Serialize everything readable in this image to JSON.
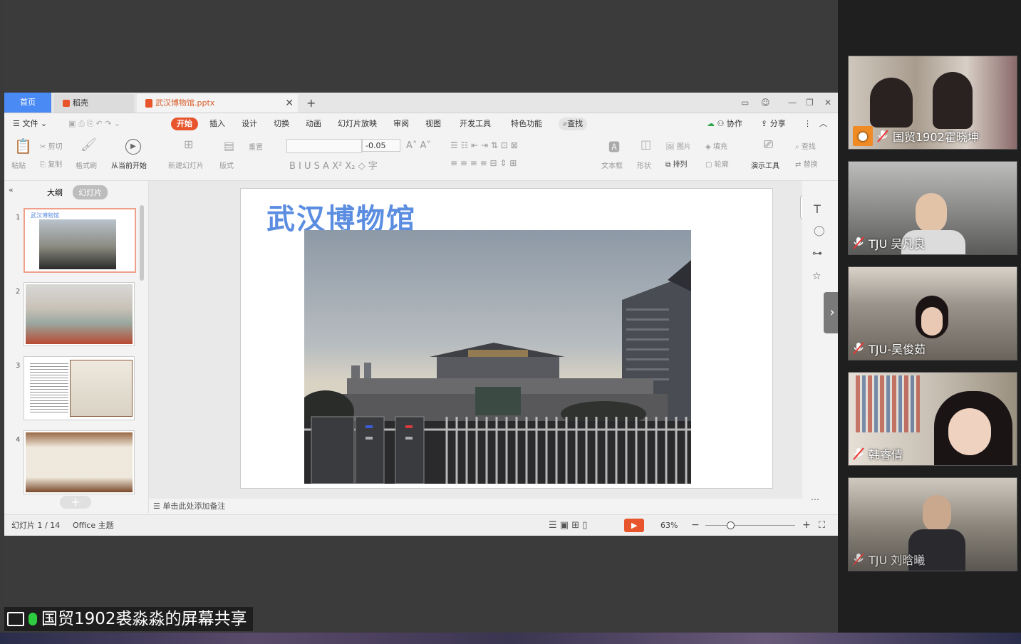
{
  "tabs": {
    "home": "首页",
    "daoke": "稻壳",
    "file": "武汉博物馆.pptx"
  },
  "menu": [
    "文件",
    "开始",
    "插入",
    "设计",
    "切换",
    "动画",
    "幻灯片放映",
    "审阅",
    "视图",
    "开发工具",
    "特色功能",
    "查找"
  ],
  "menu_right": {
    "collab": "协作",
    "share": "分享"
  },
  "ribbon": {
    "paste": "粘贴",
    "cut": "剪切",
    "copy": "复制",
    "format_painter": "格式刷",
    "play_from_current": "从当前开始",
    "new_slide": "新建幻灯片",
    "layout": "版式",
    "reset": "重置",
    "font_size": "-0.05",
    "textbox": "文本框",
    "shape": "形状",
    "picture": "图片",
    "fill": "填充",
    "arrange": "排列",
    "outline": "轮廓",
    "present_tools": "演示工具",
    "find": "查找",
    "replace": "替换"
  },
  "left_panel": {
    "tab_outline": "大纲",
    "tab_slides": "幻灯片",
    "thumb1_title": "武汉博物馆",
    "numbers": [
      "1",
      "2",
      "3",
      "4"
    ]
  },
  "slide": {
    "title": "武汉博物馆"
  },
  "notes_placeholder": "单击此处添加备注",
  "status": {
    "slide_count": "幻灯片 1 / 14",
    "theme": "Office 主题",
    "zoom": "63%"
  },
  "participants": [
    {
      "name": "国贸1902霍晓坤"
    },
    {
      "name": "TJU 吴凡良"
    },
    {
      "name": "TJU-吴俊茹"
    },
    {
      "name": "韩睿倩"
    },
    {
      "name": "TJU 刘晗曦"
    }
  ],
  "share_banner": "国贸1902裘淼淼的屏幕共享"
}
